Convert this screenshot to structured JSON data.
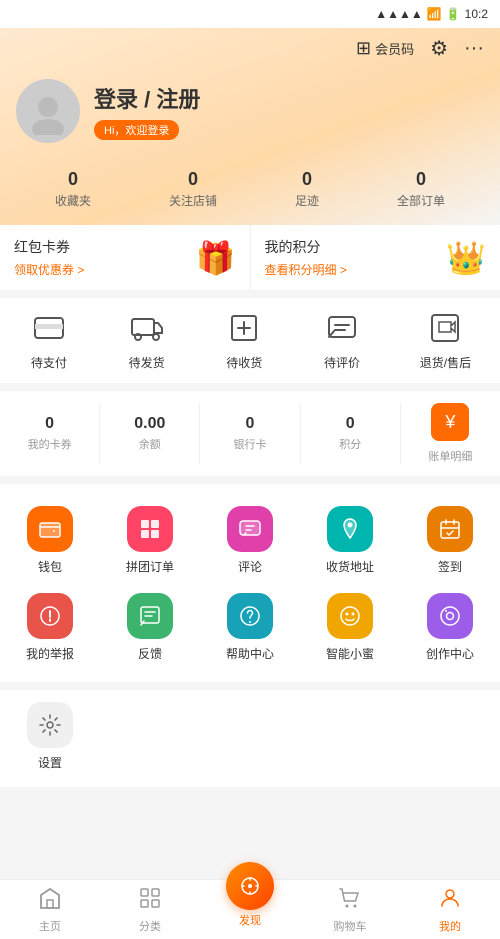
{
  "statusBar": {
    "time": "10:2",
    "batteryIcon": "🔋",
    "wifiIcon": "📶"
  },
  "header": {
    "memberCodeLabel": "会员码",
    "settingsTitle": "设置",
    "moreTitle": "更多"
  },
  "user": {
    "name": "登录 / 注册",
    "welcomeText": "Hi，欢迎登录"
  },
  "stats": [
    {
      "id": "favorites",
      "value": "0",
      "label": "收藏夹"
    },
    {
      "id": "followed-stores",
      "value": "0",
      "label": "关注店铺"
    },
    {
      "id": "footprint",
      "value": "0",
      "label": "足迹"
    },
    {
      "id": "all-orders",
      "value": "0",
      "label": "全部订单"
    }
  ],
  "cards": {
    "voucher": {
      "title": "红包卡券",
      "link": "领取优惠券 >"
    },
    "points": {
      "title": "我的积分",
      "link": "查看积分明细 >"
    }
  },
  "orders": {
    "items": [
      {
        "id": "pending-payment",
        "label": "待支付",
        "icon": "💳"
      },
      {
        "id": "pending-delivery",
        "label": "待发货",
        "icon": "📦"
      },
      {
        "id": "pending-receipt",
        "label": "待收货",
        "icon": "🚚"
      },
      {
        "id": "pending-review",
        "label": "待评价",
        "icon": "💬"
      },
      {
        "id": "returns",
        "label": "退货/售后",
        "icon": "🔄"
      }
    ]
  },
  "wallet": {
    "items": [
      {
        "id": "my-vouchers",
        "value": "0",
        "label": "我的卡券"
      },
      {
        "id": "balance",
        "value": "0.00",
        "label": "余额"
      },
      {
        "id": "bank-card",
        "value": "0",
        "label": "银行卡"
      },
      {
        "id": "points-val",
        "value": "0",
        "label": "积分"
      },
      {
        "id": "bill-detail",
        "label": "账单明细",
        "isIcon": true
      }
    ]
  },
  "features": [
    {
      "id": "wallet",
      "label": "钱包",
      "colorClass": "icon-orange",
      "icon": "👛"
    },
    {
      "id": "group-order",
      "label": "拼团订单",
      "colorClass": "icon-pink",
      "icon": "🧩"
    },
    {
      "id": "review",
      "label": "评论",
      "colorClass": "icon-magenta",
      "icon": "💬"
    },
    {
      "id": "shipping-addr",
      "label": "收货地址",
      "colorClass": "icon-teal",
      "icon": "📍"
    },
    {
      "id": "checkin",
      "label": "签到",
      "colorClass": "icon-darkorange",
      "icon": "📅"
    },
    {
      "id": "report",
      "label": "我的举报",
      "colorClass": "icon-red",
      "icon": "🚨"
    },
    {
      "id": "feedback",
      "label": "反馈",
      "colorClass": "icon-green",
      "icon": "📋"
    },
    {
      "id": "help",
      "label": "帮助中心",
      "colorClass": "icon-cyan",
      "icon": "❓"
    },
    {
      "id": "ai-bee",
      "label": "智能小蜜",
      "colorClass": "icon-yellow",
      "icon": "😊"
    },
    {
      "id": "creation",
      "label": "创作中心",
      "colorClass": "icon-purple",
      "icon": "📷"
    }
  ],
  "settings": {
    "label": "设置"
  },
  "bottomNav": [
    {
      "id": "home",
      "label": "主页",
      "icon": "🏠",
      "active": false
    },
    {
      "id": "category",
      "label": "分类",
      "icon": "⊞",
      "active": false
    },
    {
      "id": "discover",
      "label": "发现",
      "icon": "◎",
      "active": false,
      "isCenter": true
    },
    {
      "id": "cart",
      "label": "购物车",
      "icon": "🛒",
      "active": false
    },
    {
      "id": "me",
      "label": "我的",
      "icon": "👤",
      "active": true
    }
  ]
}
